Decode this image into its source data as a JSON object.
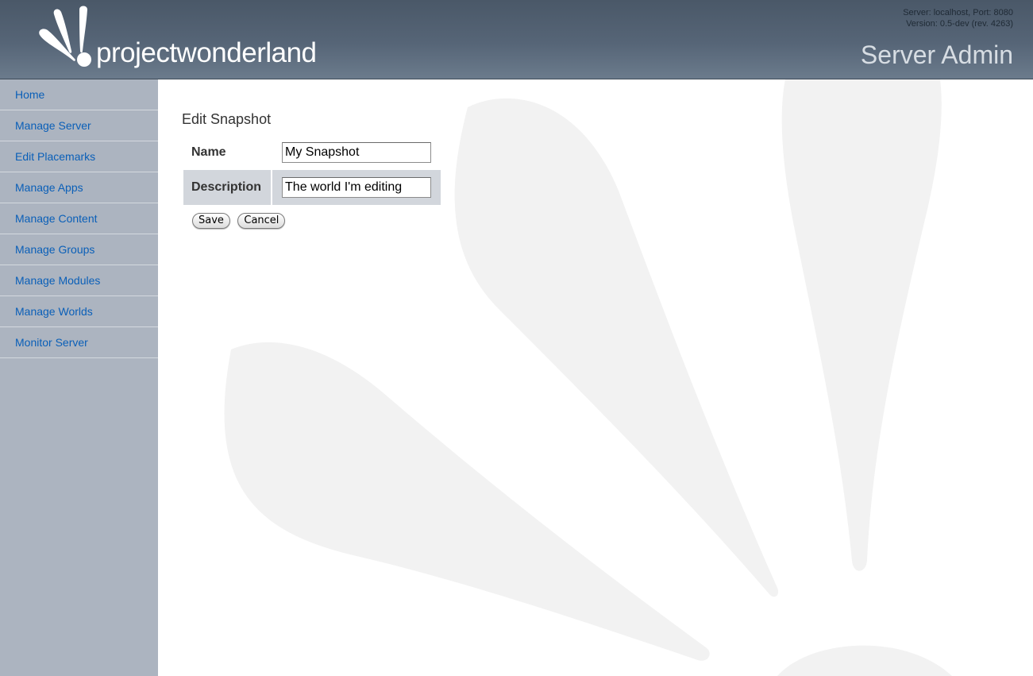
{
  "header": {
    "logo_text": "projectwonderland",
    "server_info_line1": "Server: localhost, Port: 8080",
    "server_info_line2": "Version: 0.5-dev (rev. 4263)",
    "title": "Server Admin",
    "gradient_colors": [
      "#4a5868",
      "#6b7b8c"
    ]
  },
  "sidebar": {
    "background": "#acb4c0",
    "link_color": "#0a5fb8",
    "items": [
      {
        "label": "Home"
      },
      {
        "label": "Manage Server"
      },
      {
        "label": "Edit Placemarks"
      },
      {
        "label": "Manage Apps"
      },
      {
        "label": "Manage Content"
      },
      {
        "label": "Manage Groups"
      },
      {
        "label": "Manage Modules"
      },
      {
        "label": "Manage Worlds"
      },
      {
        "label": "Monitor Server"
      }
    ]
  },
  "main": {
    "title": "Edit Snapshot",
    "fields": {
      "name": {
        "label": "Name",
        "value": "My Snapshot"
      },
      "description": {
        "label": "Description",
        "value": "The world I'm editing"
      }
    },
    "buttons": {
      "save": "Save",
      "cancel": "Cancel"
    }
  }
}
